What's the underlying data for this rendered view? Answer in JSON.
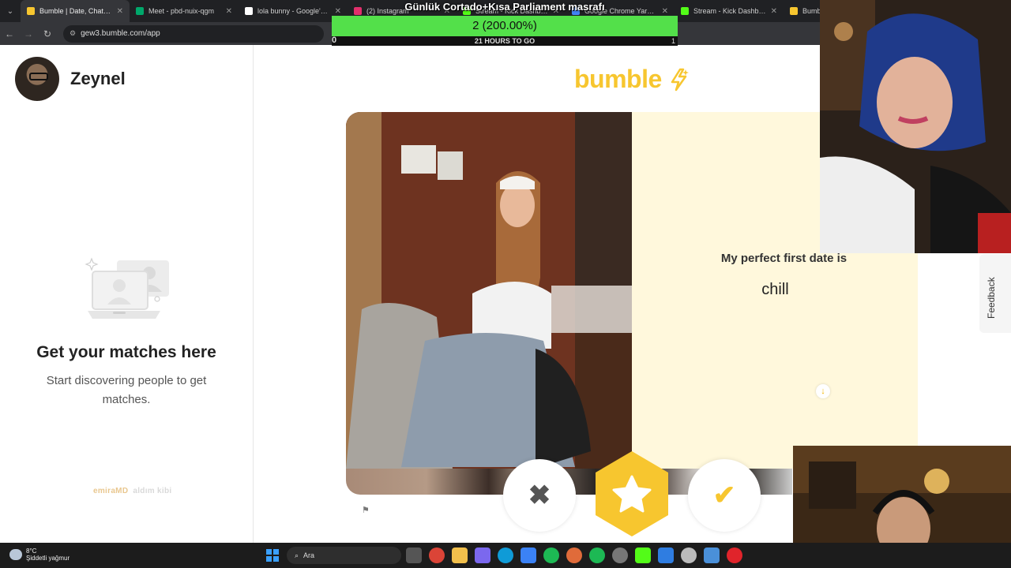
{
  "browser": {
    "tabs": [
      {
        "title": "Bumble | Date, Chat, Meet",
        "favicon_color": "#f7c62f",
        "active": true
      },
      {
        "title": "Meet - pbd-nuix-qgm",
        "favicon_color": "#00a86b",
        "active": false
      },
      {
        "title": "lola bunny - Google'da Ara",
        "favicon_color": "#ffffff",
        "active": false
      },
      {
        "title": "(2) Instagram",
        "favicon_color": "#e1306c",
        "active": false
      },
      {
        "title": "Stream - Kick Dashboard",
        "favicon_color": "#53fc18",
        "active": false
      },
      {
        "title": "Google Chrome Yardım",
        "favicon_color": "#4285f4",
        "active": false
      },
      {
        "title": "Stream - Kick Dashboard",
        "favicon_color": "#53fc18",
        "active": false
      },
      {
        "title": "Bumb",
        "favicon_color": "#f7c62f",
        "active": false
      }
    ],
    "url": "gew3.bumble.com/app"
  },
  "stream_goal": {
    "title": "Günlük Cortado+Kısa Parliament masrafı",
    "progress_text": "2 (200.00%)",
    "progress_fraction": 1.0,
    "min_label": "0",
    "time_left": "21 HOURS TO GO",
    "max_label": "1",
    "fill_color": "#53e04a"
  },
  "sidebar": {
    "user_name": "Zeynel",
    "empty_title": "Get your matches here",
    "empty_subtitle": "Start discovering people to get matches.",
    "watermark_a": "emiraMD",
    "watermark_b": "aldım kibi"
  },
  "main": {
    "logo_text": "bumble",
    "prompt": "My perfect first date is",
    "answer": "chill",
    "pass_icon": "close-icon",
    "superswipe_icon": "star-icon",
    "like_icon": "check-icon"
  },
  "feedback_label": "Feedback",
  "taskbar": {
    "weather_temp": "8°C",
    "weather_desc": "Şiddetli yağmur",
    "search_placeholder": "Ara"
  },
  "colors": {
    "brand_yellow": "#f7c62f",
    "card_info_bg": "#fff8dc"
  }
}
